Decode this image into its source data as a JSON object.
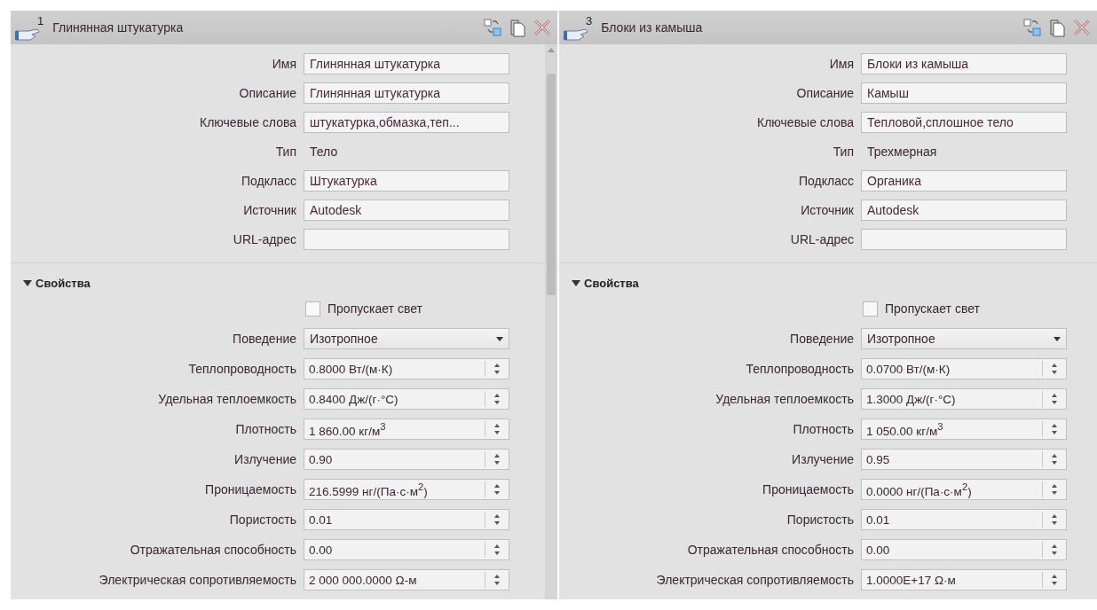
{
  "panels": [
    {
      "number": "1",
      "title": "Глинянная штукатурка",
      "has_scrollbar": true,
      "info": [
        {
          "label": "Имя",
          "kind": "text",
          "value": "Глинянная штукатурка"
        },
        {
          "label": "Описание",
          "kind": "text",
          "value": "Глинянная штукатурка"
        },
        {
          "label": "Ключевые слова",
          "kind": "text",
          "value": "штукатурка,обмазка,теп..."
        },
        {
          "label": "Тип",
          "kind": "static",
          "value": "Тело"
        },
        {
          "label": "Подкласс",
          "kind": "text",
          "value": "Штукатурка"
        },
        {
          "label": "Источник",
          "kind": "text",
          "value": "Autodesk"
        },
        {
          "label": "URL-адрес",
          "kind": "text"
        }
      ],
      "section": {
        "title": "Свойства",
        "expanded": true
      },
      "properties": [
        {
          "kind": "checkbox",
          "value": "Пропускает свет",
          "checked": false
        },
        {
          "kind": "dropdown",
          "label": "Поведение",
          "value": "Изотропное"
        },
        {
          "kind": "spinner",
          "label": "Теплопроводность",
          "value": "0.8000 Вт/(м·К)"
        },
        {
          "kind": "spinner",
          "label": "Удельная теплоемкость",
          "value": "0.8400 Дж/(г·°C)"
        },
        {
          "kind": "spinner",
          "label": "Плотность",
          "value": "1 860.00 кг/м$^{3}$"
        },
        {
          "kind": "spinner",
          "label": "Излучение",
          "value": "0.90"
        },
        {
          "kind": "spinner",
          "label": "Проницаемость",
          "value": "216.5999 нг/(Па·с·м$^{2}$)"
        },
        {
          "kind": "spinner",
          "label": "Пористость",
          "value": "0.01"
        },
        {
          "kind": "spinner",
          "label": "Отражательная способность",
          "value": "0.00"
        },
        {
          "kind": "spinner",
          "label": "Электрическая сопротивляемость",
          "value": "2 000 000.0000 Ω-м"
        }
      ]
    },
    {
      "number": "3",
      "title": "Блоки из камыша",
      "has_scrollbar": false,
      "info": [
        {
          "label": "Имя",
          "kind": "text",
          "value": "Блоки из камыша"
        },
        {
          "label": "Описание",
          "kind": "text",
          "value": "Камыш"
        },
        {
          "label": "Ключевые слова",
          "kind": "text",
          "value": "Тепловой,сплошное тело"
        },
        {
          "label": "Тип",
          "kind": "static",
          "value": "Трехмерная"
        },
        {
          "label": "Подкласс",
          "kind": "text",
          "value": "Органика"
        },
        {
          "label": "Источник",
          "kind": "text",
          "value": "Autodesk"
        },
        {
          "label": "URL-адрес",
          "kind": "text"
        }
      ],
      "section": {
        "title": "Свойства",
        "expanded": true
      },
      "properties": [
        {
          "kind": "checkbox",
          "value": "Пропускает свет",
          "checked": false
        },
        {
          "kind": "dropdown",
          "label": "Поведение",
          "value": "Изотропное"
        },
        {
          "kind": "spinner",
          "label": "Теплопроводность",
          "value": "0.0700 Вт/(м·К)"
        },
        {
          "kind": "spinner",
          "label": "Удельная теплоемкость",
          "value": "1.3000 Дж/(г·°C)"
        },
        {
          "kind": "spinner",
          "label": "Плотность",
          "value": "1 050.00 кг/м$^{3}$"
        },
        {
          "kind": "spinner",
          "label": "Излучение",
          "value": "0.95"
        },
        {
          "kind": "spinner",
          "label": "Проницаемость",
          "value": "0.0000 нг/(Па·с·м$^{2}$)"
        },
        {
          "kind": "spinner",
          "label": "Пористость",
          "value": "0.01"
        },
        {
          "kind": "spinner",
          "label": "Отражательная способность",
          "value": "0.00"
        },
        {
          "kind": "spinner",
          "label": "Электрическая сопротивляемость",
          "value": "1.0000E+17 Ω·м"
        }
      ]
    }
  ]
}
